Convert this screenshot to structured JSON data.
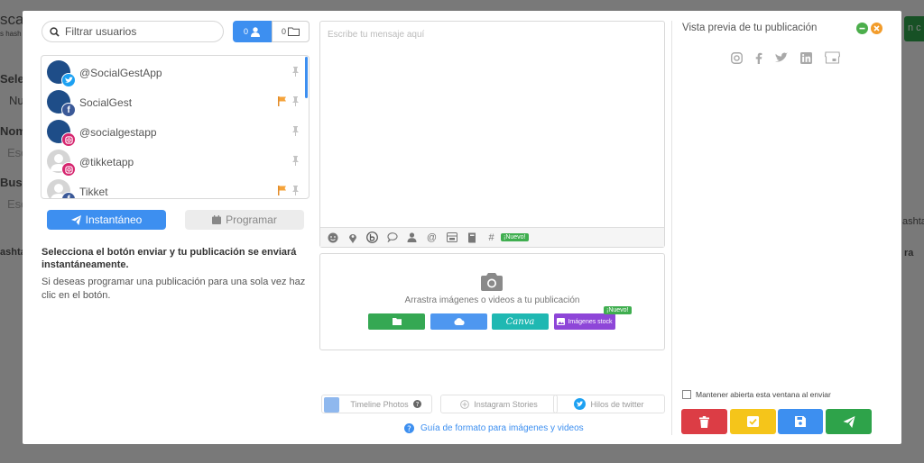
{
  "background_page": {
    "fragments": [
      "scac",
      "s hash",
      "Selec",
      "Nu",
      "Nom",
      "Esc",
      "Busc",
      "Esc",
      "ashta",
      "ashta",
      "ra"
    ],
    "right_button_fragment": "n c"
  },
  "user_filter": {
    "search_placeholder": "Filtrar usuarios",
    "users_count": "0",
    "folders_count": "0"
  },
  "accounts": [
    {
      "name": "@SocialGestApp",
      "network": "twitter",
      "flagged": false
    },
    {
      "name": "SocialGest",
      "network": "facebook",
      "flagged": true
    },
    {
      "name": "@socialgestapp",
      "network": "instagram",
      "flagged": false
    },
    {
      "name": "@tikketapp",
      "network": "instagram",
      "flagged": false
    },
    {
      "name": "Tikket",
      "network": "facebook",
      "flagged": true
    }
  ],
  "mode": {
    "instant_label": "Instantáneo",
    "schedule_label": "Programar",
    "instant_info_bold": "Selecciona el botón enviar y tu publicación se enviará instantáneamente.",
    "instant_info": "Si deseas programar una publicación para una sola vez haz clic en el botón."
  },
  "composer": {
    "placeholder": "Escribe tu mensaje aquí",
    "toolbar_new_badge": "¡Nuevo!"
  },
  "media": {
    "drop_text": "Arrastra imágenes o videos a tu publicación",
    "canva_label": "Canva",
    "stock_label": "Imágenes stock",
    "stock_new_badge": "¡Nuevo!"
  },
  "publish_types": {
    "timeline": "Timeline Photos",
    "stories": "Instagram Stories",
    "twitter_threads": "Hilos de twitter"
  },
  "guide_link": "Guía de formato para imágenes y videos",
  "preview": {
    "title": "Vista previa de tu publicación",
    "networks": [
      "instagram-icon",
      "facebook-icon",
      "twitter-icon",
      "linkedin-icon",
      "gmb-icon"
    ]
  },
  "keep_open_label": "Mantener abierta esta ventana al enviar",
  "colors": {
    "primary": "#3d8ff0",
    "success": "#2ea34a",
    "danger": "#dc3d45",
    "warning": "#f5c51a",
    "canva": "#1fb8b2",
    "stock": "#8e46d8"
  }
}
